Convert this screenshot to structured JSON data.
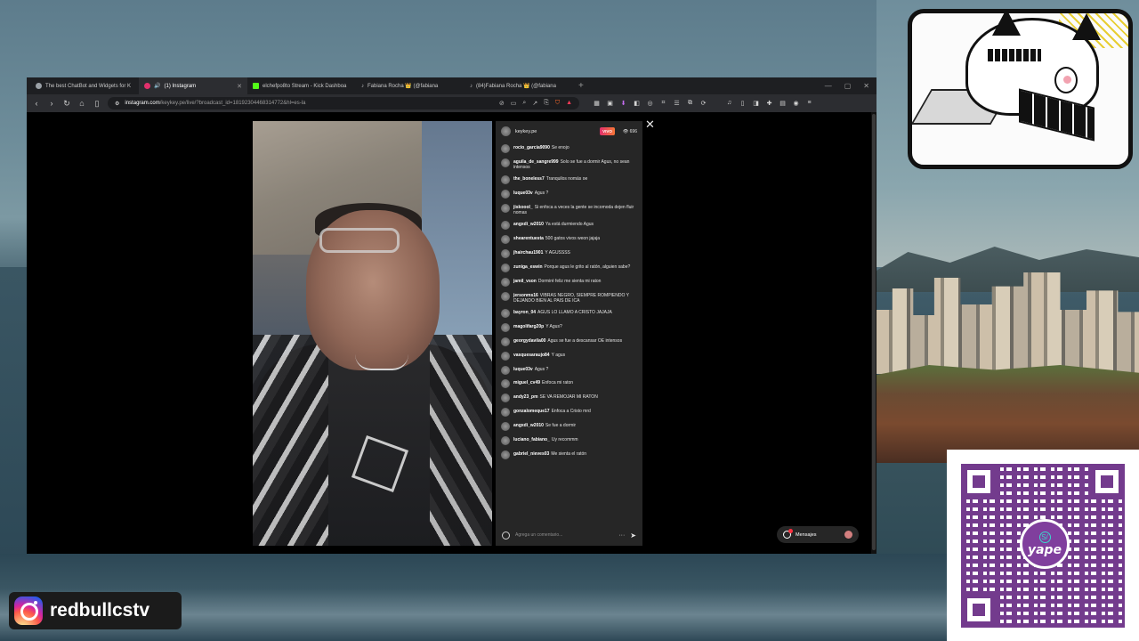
{
  "browser": {
    "tabs": [
      {
        "title": "The best ChatBot and Widgets for K",
        "icon": "shield-tab-icon",
        "color": "#9aa0a6"
      },
      {
        "title": "(1) Instagram",
        "icon": "instagram-icon",
        "color": "#e1306c",
        "active": true
      },
      {
        "title": "elchefpo8to Stream - Kick Dashboa",
        "icon": "kick-icon",
        "color": "#53fc18"
      },
      {
        "title": "Fabiana Rocha 👑 (@fabiana",
        "icon": "tiktok-icon",
        "color": "#ffffff"
      },
      {
        "title": "(84)Fabiana Rocha 👑 (@fabiana",
        "icon": "tiktok-icon",
        "color": "#ffffff"
      }
    ],
    "url_host": "instagram.com",
    "url_path": "/keykey.pe/live/?broadcast_id=18192304468314772&hl=es-la"
  },
  "chat": {
    "host_username": "keykey.pe",
    "live_label": "VIVO",
    "viewer_count": "696",
    "comments": [
      {
        "user": "rocio_garcia9090",
        "text": "Se enojo"
      },
      {
        "user": "aguila_de_sangre999",
        "text": "Solo se fue a dormir Agus, no sean intensos"
      },
      {
        "user": "the_boneless7",
        "text": "Tranquilos nomás oe"
      },
      {
        "user": "luque03v",
        "text": "Agus ?"
      },
      {
        "user": "jiskoool_",
        "text": "Si enfoca a veces la gente se incomoda dejen fluir nomas"
      },
      {
        "user": "angxdi_w2010",
        "text": "Ya está durmiendo Agus"
      },
      {
        "user": "shearentuesta",
        "text": "500 gatos vivos weon jajaja"
      },
      {
        "user": "jhairchau1901",
        "text": "Y AGUSSSS"
      },
      {
        "user": "zuniga_eswin",
        "text": "Porque agus le grito al ratón, alguien sabe?"
      },
      {
        "user": "jamil_vson",
        "text": "Dormiré feliz me sienta mi raton"
      },
      {
        "user": "jersonms16",
        "text": "VIBRAS NEGRO, SIEMPRE ROMPIENDO Y DEJANDO BIEN AL PAIS DE ICA"
      },
      {
        "user": "bayron_04",
        "text": "AGUS LO LLAMO A CRISTO JAJAJA"
      },
      {
        "user": "magolifarg20p",
        "text": "Y Agus?"
      },
      {
        "user": "georgydavila00",
        "text": "Agus se fue a descansar OE intensos"
      },
      {
        "user": "vasquesaraujo84",
        "text": "Y agus"
      },
      {
        "user": "luque03v",
        "text": "Agus ?"
      },
      {
        "user": "miguel_cv49",
        "text": "Enfoca mi raton"
      },
      {
        "user": "andy23_pm",
        "text": "SE VA REMOJAR MI RATON"
      },
      {
        "user": "gonzalomeque17",
        "text": "Enfoca a Cristo mrd"
      },
      {
        "user": "angxdi_w2010",
        "text": "Se fue a dormir"
      },
      {
        "user": "luciano_fabiano_",
        "text": "Uy recommm"
      },
      {
        "user": "gabriel_nieves03",
        "text": "Me sienta el ratón"
      }
    ],
    "input_placeholder": "Agrega un comentario...",
    "more_label": "···"
  },
  "messages_label": "Mensajes",
  "overlays": {
    "instagram_handle": "redbullcstv",
    "yape_label": "yape",
    "yape_currency": "S/"
  },
  "colors": {
    "accent_live": "#e1306c",
    "yape_purple": "#6a1e8c"
  }
}
